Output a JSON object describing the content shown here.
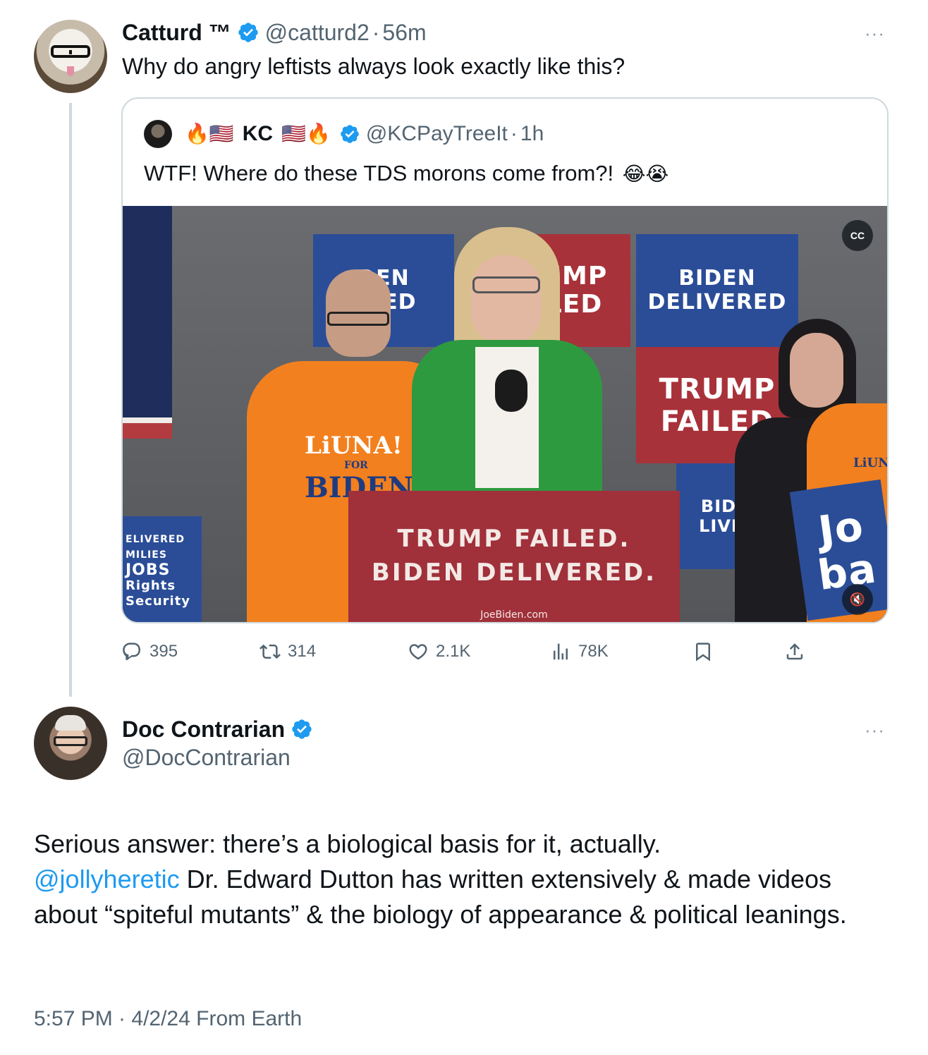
{
  "tweet1": {
    "name": "Catturd ™",
    "handle": "@catturd2",
    "time": "56m",
    "text": "Why do angry leftists always look exactly like this?",
    "more_label": "···"
  },
  "quote": {
    "name_prefix_emoji": "🔥🇺🇸",
    "name": "KC",
    "name_suffix_emoji": "🇺🇸🔥",
    "handle": "@KCPayTreeIt",
    "time": "1h",
    "text": "WTF! Where do these TDS morons come from?!",
    "text_emoji": "😂😭",
    "media": {
      "podium_line1": "TRUMP FAILED.",
      "podium_line2": "BIDEN DELIVERED.",
      "podium_line3": "JoeBiden.com",
      "sign_a1": "BIDEN",
      "sign_a2": "DELIVERED",
      "sign_b1": "TRUMP",
      "sign_b2": "FAILED",
      "sign_c1": "UMP",
      "sign_c2": "LED",
      "sign_d1": "DEN",
      "sign_d2": "ERED",
      "sign_e1": "BID",
      "sign_e2": "LIVI",
      "shirt_text1": "LiUNA!",
      "shirt_text2": "FOR",
      "shirt_text3": "BIDEN",
      "left_sign1": "ELIVERED",
      "left_sign2": "MILIES",
      "left_sign3": "JOBS",
      "left_sign4": "Rights",
      "left_sign5": "Security",
      "right_sign1": "Jo",
      "right_sign2": "ba",
      "right_shirt": "LiUN",
      "cc_label": "CC",
      "mute_label": "🔇"
    }
  },
  "actions": {
    "replies": "395",
    "reposts": "314",
    "likes": "2.1K",
    "views": "78K"
  },
  "tweet2": {
    "name": "Doc Contrarian",
    "handle": "@DocContrarian",
    "more_label": "···",
    "text_line1": "Serious answer: there’s a biological basis for it, actually.",
    "mention": "@jollyheretic",
    "text_rest": " Dr. Edward Dutton has written extensively & made videos about “spiteful mutants” & the biology of appearance & political leanings.",
    "meta": "5:57 PM · 4/2/24 From Earth"
  },
  "colors": {
    "accent": "#1d9bf0",
    "muted": "#536471",
    "border": "#cfd9de"
  },
  "icons": [
    "verified-badge-icon",
    "more-icon",
    "reply-icon",
    "repost-icon",
    "like-icon",
    "views-icon",
    "bookmark-icon",
    "share-icon",
    "captions-icon",
    "mute-icon"
  ]
}
